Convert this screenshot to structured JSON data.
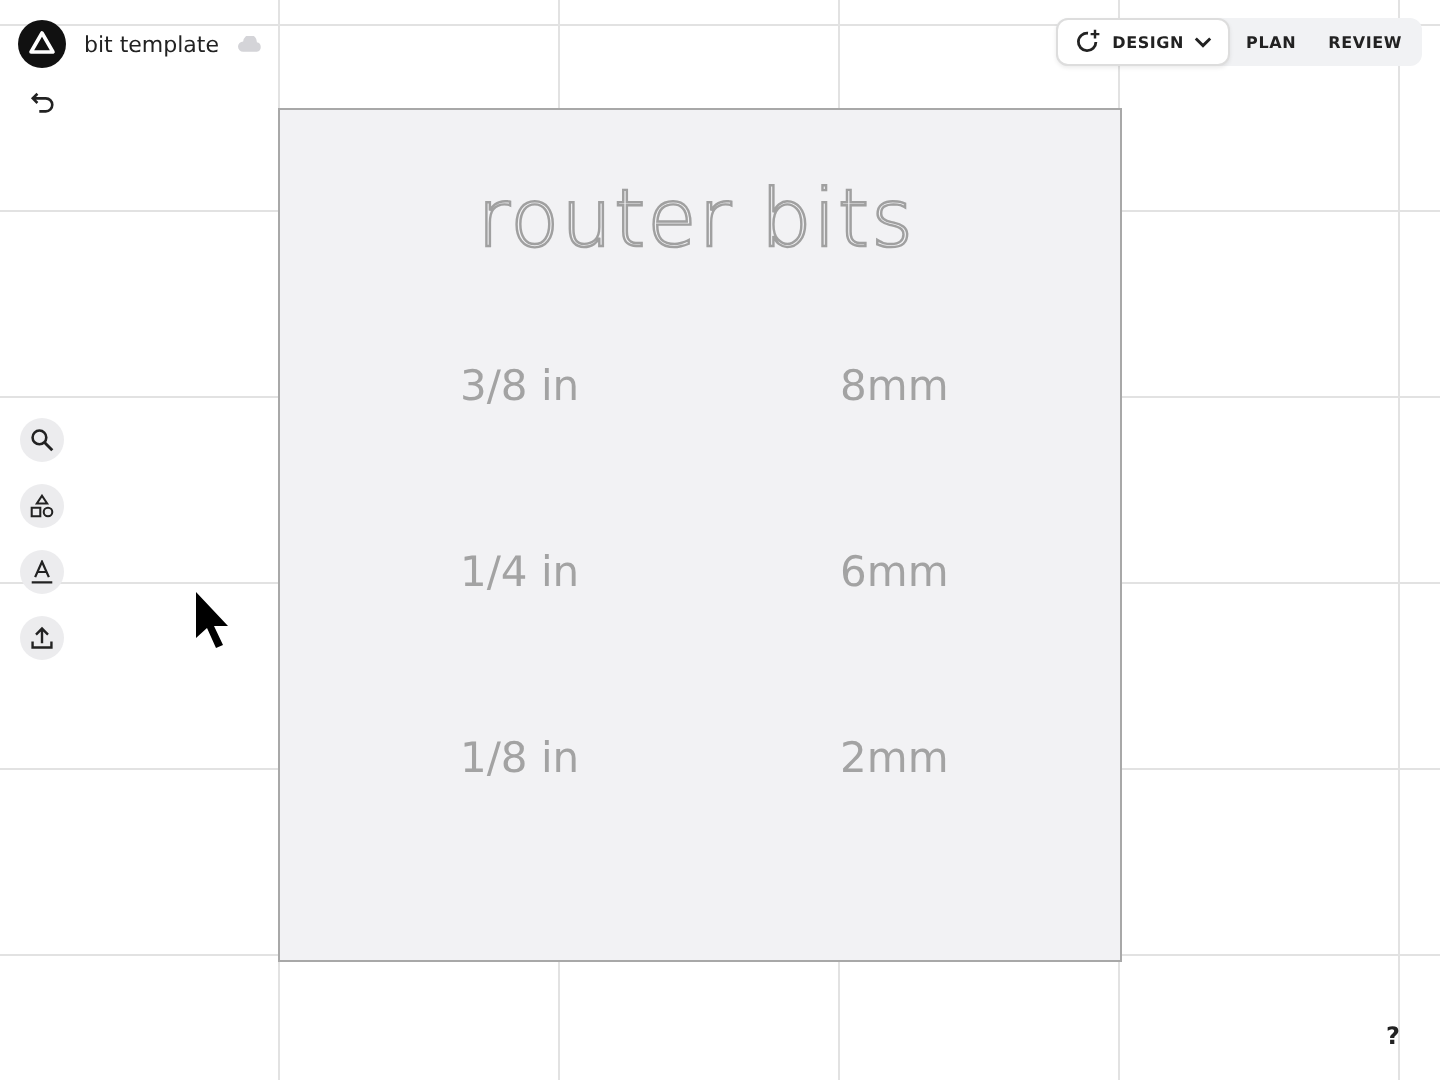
{
  "document": {
    "title": "bit template"
  },
  "tabs": [
    {
      "label": "DESIGN",
      "selected": true
    },
    {
      "label": "PLAN",
      "selected": false
    },
    {
      "label": "REVIEW",
      "selected": false
    }
  ],
  "artboard": {
    "title": "router bits",
    "rows": [
      {
        "imperial": "3/8 in",
        "metric": "8mm"
      },
      {
        "imperial": "1/4 in",
        "metric": "6mm"
      },
      {
        "imperial": "1/8 in",
        "metric": "2mm"
      }
    ]
  },
  "help": "?"
}
